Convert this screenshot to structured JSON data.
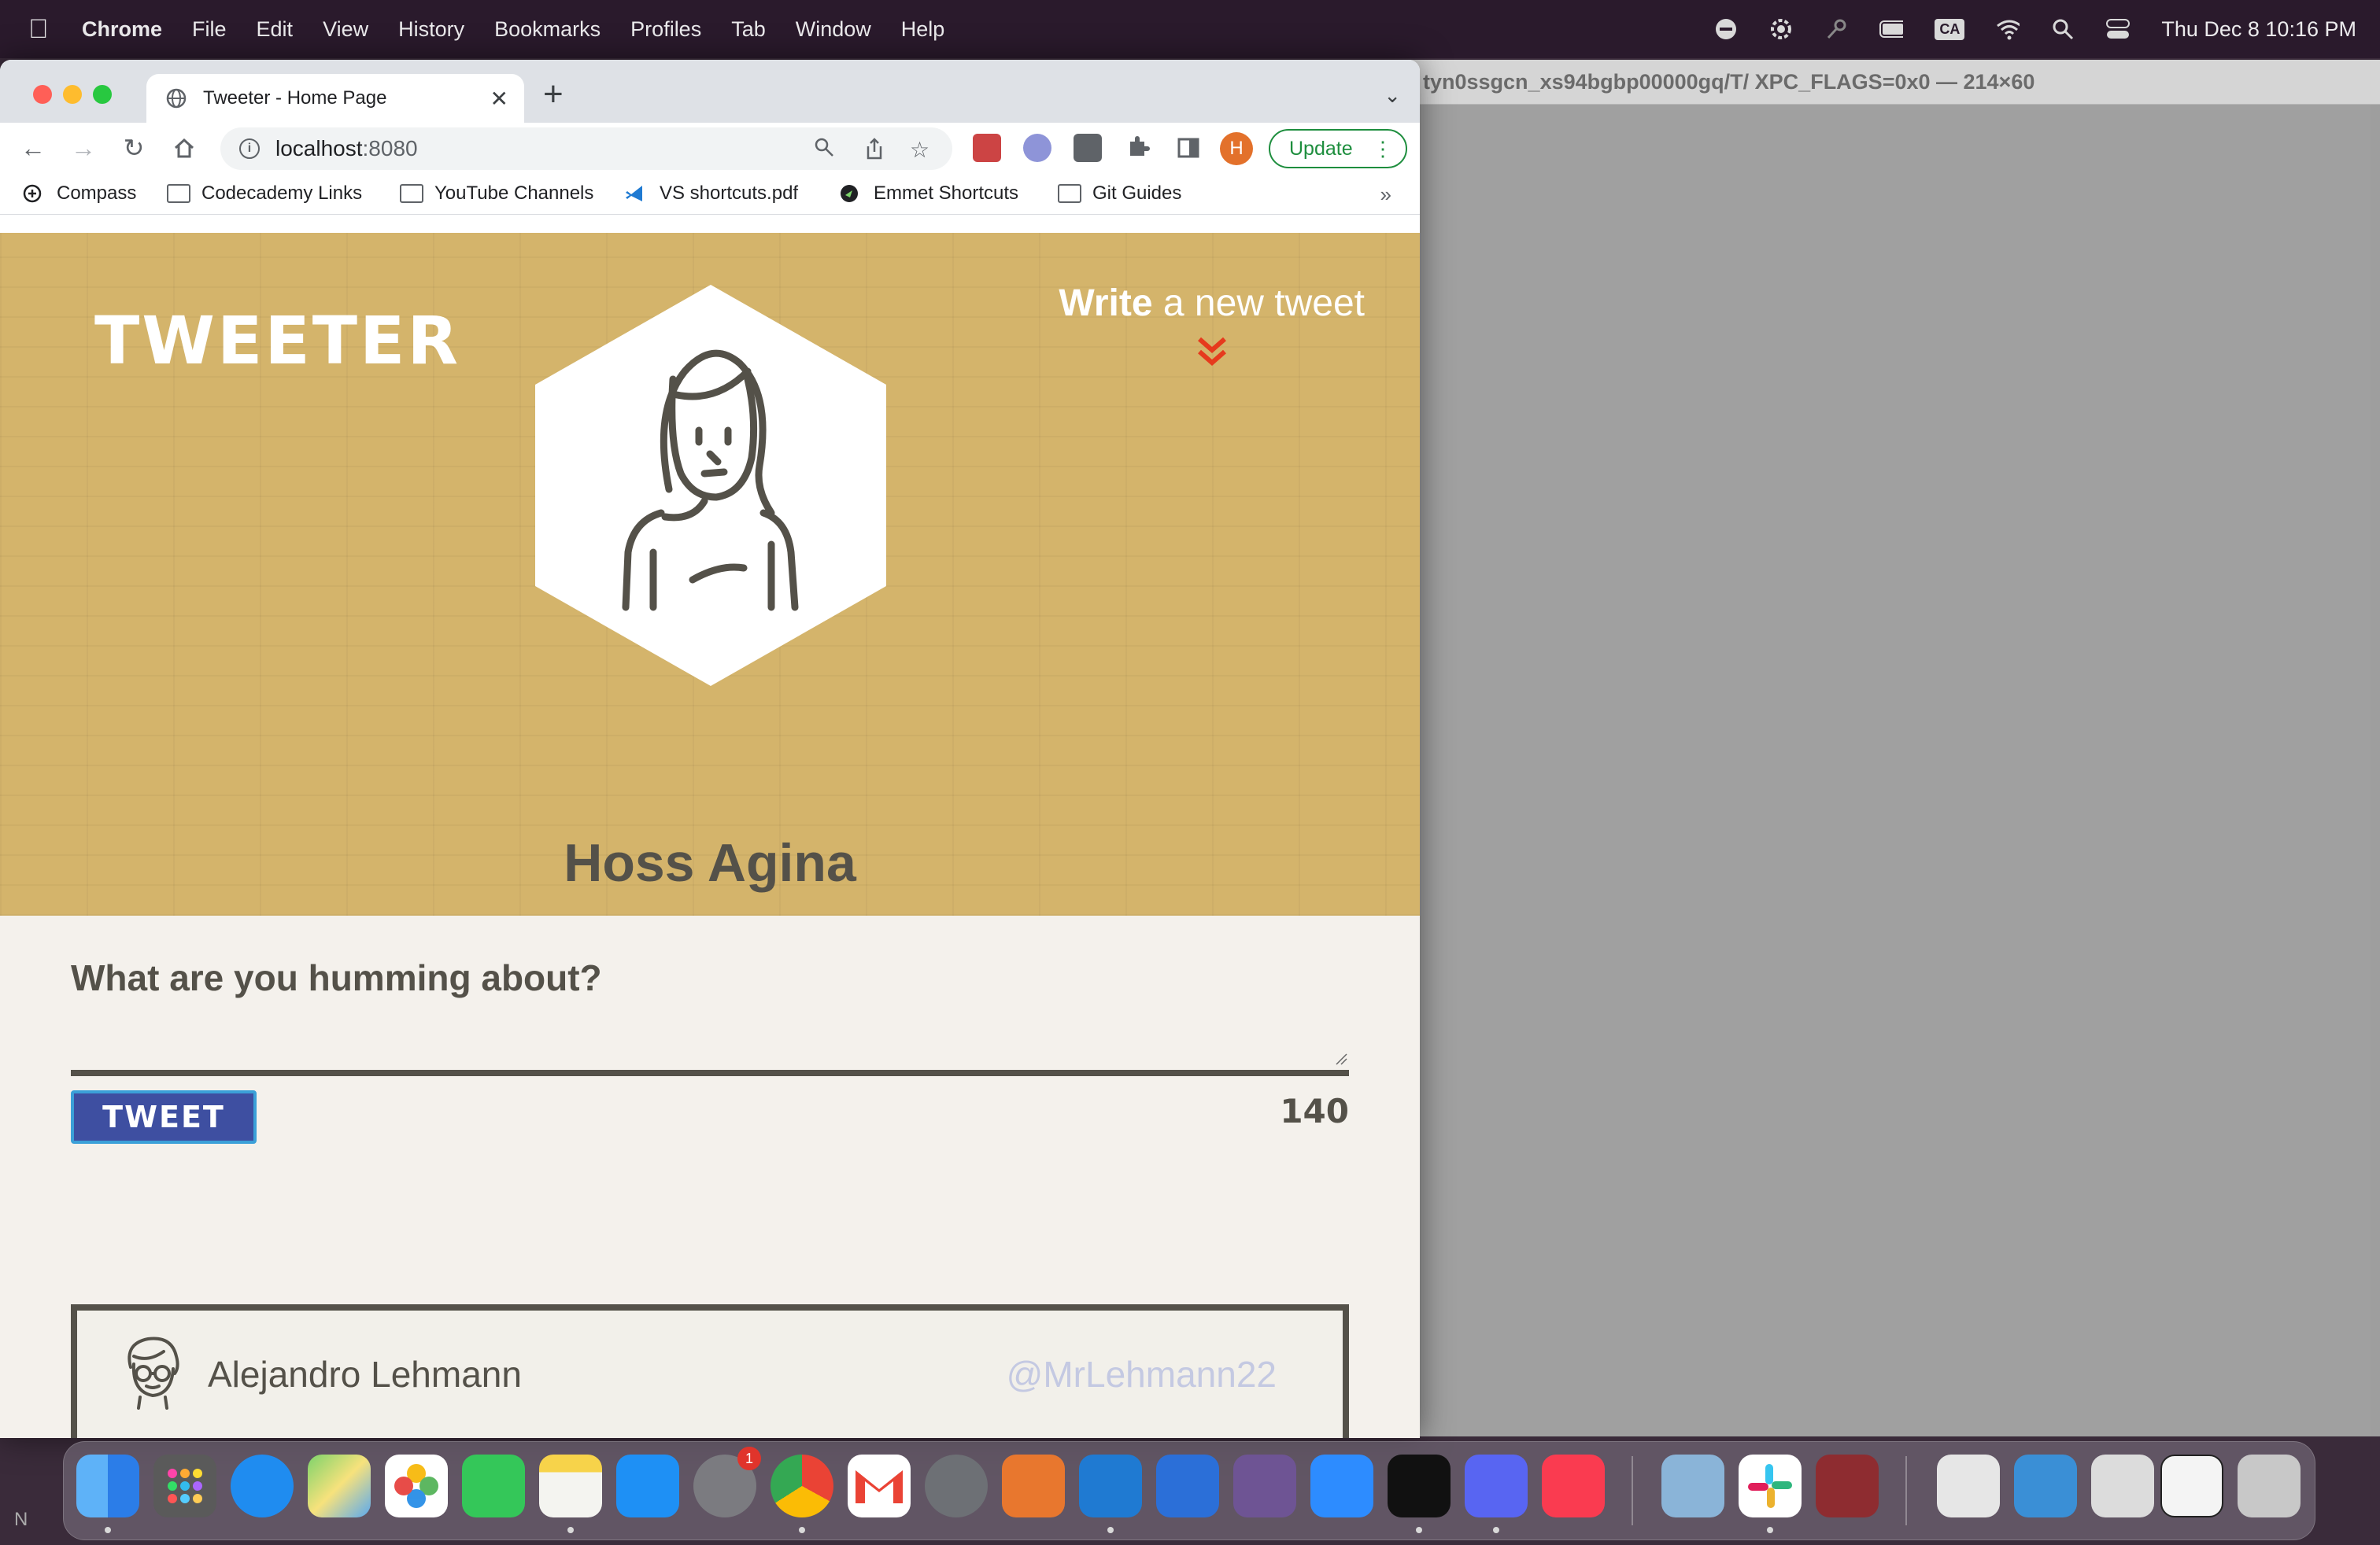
{
  "menubar": {
    "app_name": "Chrome",
    "menus": [
      "File",
      "Edit",
      "View",
      "History",
      "Bookmarks",
      "Profiles",
      "Tab",
      "Window",
      "Help"
    ],
    "input_badge": "CA",
    "clock": "Thu Dec 8  10:16 PM"
  },
  "background_window": {
    "title": "tyn0ssgcn_xs94bgbp00000gq/T/ XPC_FLAGS=0x0 — 214×60"
  },
  "browser": {
    "tab_title": "Tweeter - Home Page",
    "url_host": "localhost",
    "url_port": ":8080",
    "profile_initial": "H",
    "update_label": "Update",
    "bookmarks": [
      "Compass",
      "Codecademy Links",
      "YouTube Channels",
      "VS shortcuts.pdf",
      "Emmet Shortcuts",
      "Git Guides"
    ],
    "bookmarks_more": "»"
  },
  "page": {
    "logo": "TWEETER",
    "write_bold": "Write",
    "write_rest": " a new tweet",
    "user_name": "Hoss Agina",
    "compose_prompt": "What are you humming about?",
    "tweet_button": "TWEET",
    "char_counter": "140",
    "tweet": {
      "name": "Alejandro Lehmann",
      "handle": "@MrLehmann22"
    }
  },
  "dock": {
    "badge_count": "1",
    "corner_text": "N"
  },
  "colors": {
    "hero_bg": "#d4b46b",
    "accent_red": "#e63a1d",
    "button_blue": "#3e4fa1",
    "text_dark": "#545149",
    "handle_color": "#c4c9e2",
    "update_green": "#1e8e3e"
  }
}
